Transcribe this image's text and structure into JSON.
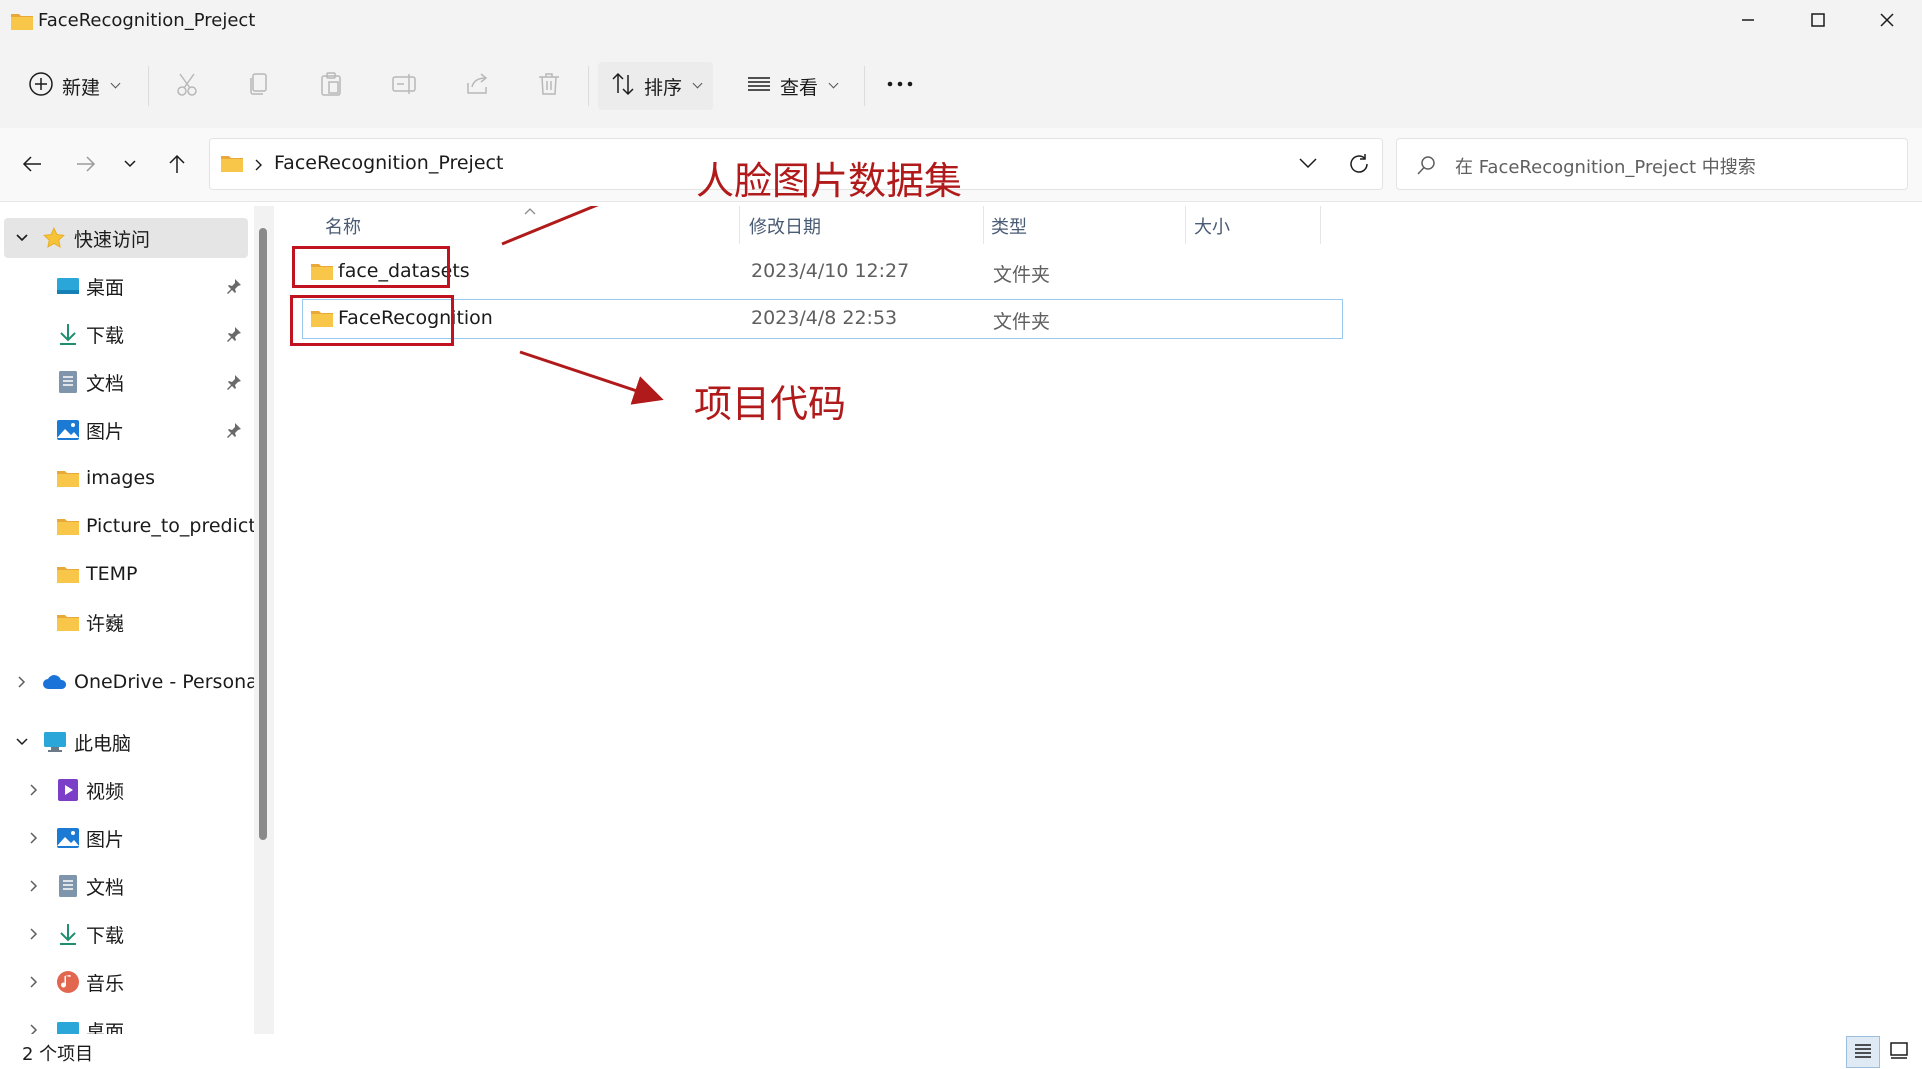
{
  "window": {
    "title": "FaceRecognition_Preject",
    "buttons": [
      "minimize-icon",
      "maximize-icon",
      "close-icon"
    ]
  },
  "toolbar": {
    "new_label": "新建",
    "sort_label": "排序",
    "view_label": "查看",
    "icons": [
      "add-icon",
      "cut-icon",
      "copy-icon",
      "paste-icon",
      "rename-icon",
      "share-icon",
      "delete-icon",
      "sort-icon",
      "view-icon",
      "more-icon"
    ]
  },
  "address": {
    "path": "FaceRecognition_Preject",
    "search_placeholder": "在 FaceRecognition_Preject 中搜索"
  },
  "sidebar": {
    "quick_access": "快速访问",
    "items": [
      {
        "label": "桌面",
        "icon": "desktop-icon",
        "pinned": true
      },
      {
        "label": "下载",
        "icon": "download-icon",
        "pinned": true
      },
      {
        "label": "文档",
        "icon": "document-icon",
        "pinned": true
      },
      {
        "label": "图片",
        "icon": "pictures-icon",
        "pinned": true
      },
      {
        "label": "images",
        "icon": "folder-icon",
        "pinned": false
      },
      {
        "label": "Picture_to_predict",
        "icon": "folder-icon",
        "pinned": false
      },
      {
        "label": "TEMP",
        "icon": "folder-icon",
        "pinned": false
      },
      {
        "label": "许巍",
        "icon": "folder-icon",
        "pinned": false
      }
    ],
    "onedrive": "OneDrive - Personal",
    "this_pc": "此电脑",
    "pc_items": [
      {
        "label": "视频",
        "icon": "videos-icon"
      },
      {
        "label": "图片",
        "icon": "pictures-icon"
      },
      {
        "label": "文档",
        "icon": "document-icon"
      },
      {
        "label": "下载",
        "icon": "download-icon"
      },
      {
        "label": "音乐",
        "icon": "music-icon"
      },
      {
        "label": "桌面",
        "icon": "desktop-icon"
      }
    ]
  },
  "columns": {
    "name": "名称",
    "date": "修改日期",
    "type": "类型",
    "size": "大小"
  },
  "files": [
    {
      "name": "face_datasets",
      "date": "2023/4/10 12:27",
      "type": "文件夹",
      "size": ""
    },
    {
      "name": "FaceRecognition",
      "date": "2023/4/8 22:53",
      "type": "文件夹",
      "size": ""
    }
  ],
  "annotations": {
    "dataset_label": "人脸图片数据集",
    "code_label": "项目代码",
    "color": "#b01a1a"
  },
  "status": {
    "count": "2 个项目"
  },
  "colors": {
    "folder": "#f8c74a",
    "accent": "#0067c0",
    "selection_border": "#99c9ef"
  }
}
